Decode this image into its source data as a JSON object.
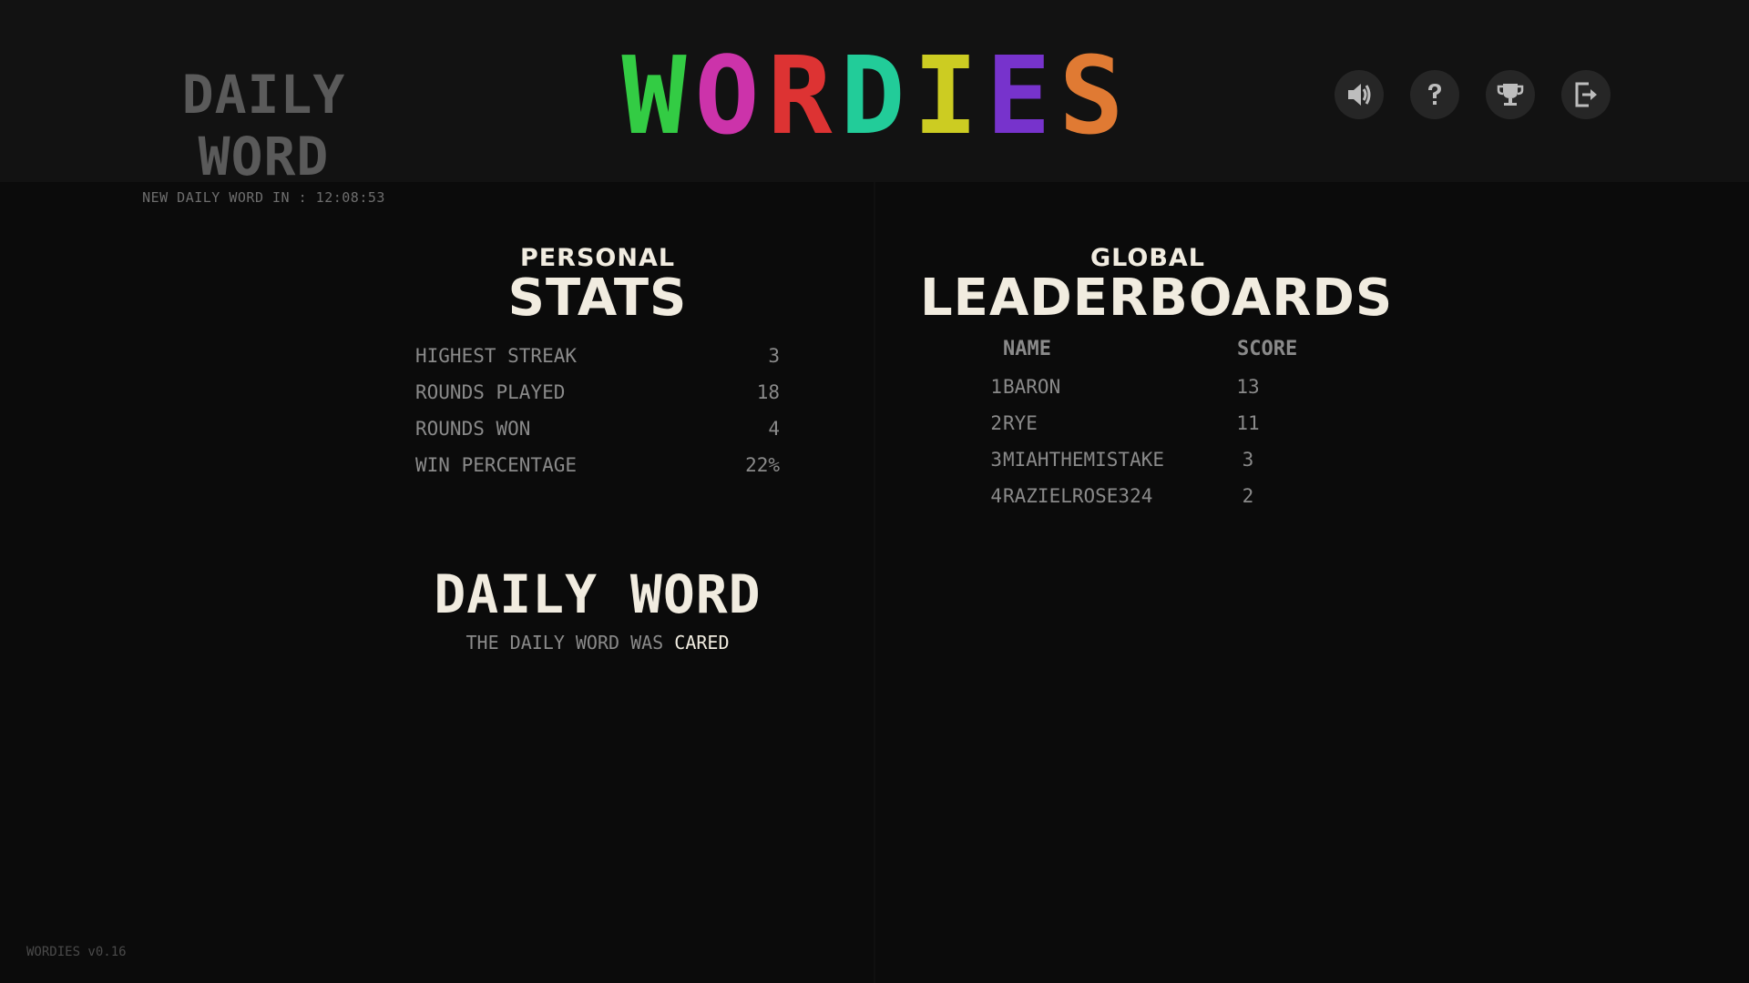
{
  "header": {
    "mode_title": "DAILY WORD",
    "mode_timer": "NEW DAILY WORD IN : 12:08:53",
    "logo_letters": [
      {
        "char": "W",
        "color": "#33cc44"
      },
      {
        "char": "O",
        "color": "#cc33aa"
      },
      {
        "char": "R",
        "color": "#dd3333"
      },
      {
        "char": "D",
        "color": "#22cc99"
      },
      {
        "char": "I",
        "color": "#cccc22"
      },
      {
        "char": "E",
        "color": "#7733cc"
      },
      {
        "char": "S",
        "color": "#e07a33"
      }
    ],
    "icons": [
      "speaker-icon",
      "help-icon",
      "trophy-icon",
      "exit-icon"
    ]
  },
  "stats": {
    "small_title": "PERSONAL",
    "big_title": "STATS",
    "rows": [
      {
        "label": "HIGHEST STREAK",
        "value": "3"
      },
      {
        "label": "ROUNDS PLAYED",
        "value": "18"
      },
      {
        "label": "ROUNDS WON",
        "value": "4"
      },
      {
        "label": "WIN PERCENTAGE",
        "value": "22%"
      }
    ]
  },
  "daily": {
    "title": "DAILY WORD",
    "message": "THE DAILY WORD WAS",
    "word": "CARED"
  },
  "leaderboard": {
    "small_title": "GLOBAL",
    "big_title": "LEADERBOARDS",
    "col_name": "NAME",
    "col_score": "SCORE",
    "rows": [
      {
        "rank": "1",
        "name": "BARON",
        "score": "13"
      },
      {
        "rank": "2",
        "name": "RYE",
        "score": "11"
      },
      {
        "rank": "3",
        "name": "MIAHTHEMISTAKE",
        "score": "3"
      },
      {
        "rank": "4",
        "name": "RAZIELROSE324",
        "score": "2"
      }
    ]
  },
  "footer": {
    "version": "WORDIES v0.16"
  }
}
